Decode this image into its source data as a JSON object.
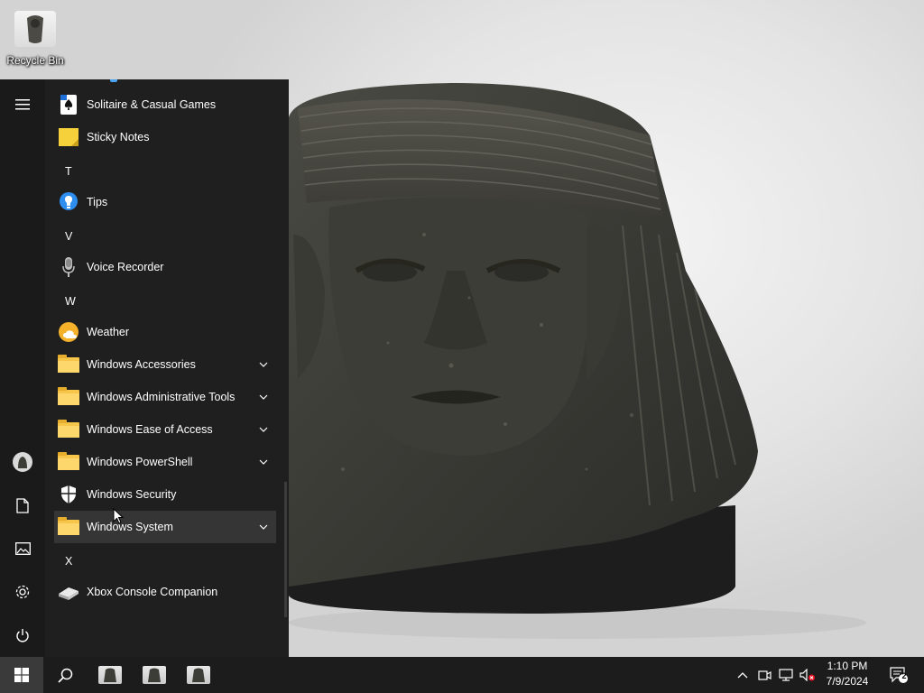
{
  "desktop": {
    "icons": [
      {
        "label": "Recycle Bin",
        "icon": "recycle-bin-icon"
      }
    ]
  },
  "start_menu": {
    "rail": {
      "menu": "hamburger-menu-icon",
      "account": "user-avatar",
      "documents": "document-icon",
      "pictures": "pictures-icon",
      "settings": "gear-icon",
      "power": "power-icon"
    },
    "apps": [
      {
        "label": "Solitaire & Casual Games",
        "icon": "solitaire-icon"
      },
      {
        "label": "Sticky Notes",
        "icon": "sticky-notes-icon"
      },
      {
        "letter": "T"
      },
      {
        "label": "Tips",
        "icon": "tips-lightbulb-icon"
      },
      {
        "letter": "V"
      },
      {
        "label": "Voice Recorder",
        "icon": "microphone-icon"
      },
      {
        "letter": "W"
      },
      {
        "label": "Weather",
        "icon": "weather-sun-icon"
      },
      {
        "label": "Windows Accessories",
        "icon": "folder-icon",
        "expandable": true
      },
      {
        "label": "Windows Administrative Tools",
        "icon": "folder-icon",
        "expandable": true
      },
      {
        "label": "Windows Ease of Access",
        "icon": "folder-icon",
        "expandable": true
      },
      {
        "label": "Windows PowerShell",
        "icon": "folder-icon",
        "expandable": true
      },
      {
        "label": "Windows Security",
        "icon": "shield-icon"
      },
      {
        "label": "Windows System",
        "icon": "folder-icon",
        "expandable": true,
        "hovered": true
      },
      {
        "letter": "X"
      },
      {
        "label": "Xbox Console Companion",
        "icon": "xbox-console-icon"
      }
    ]
  },
  "taskbar": {
    "start": "windows-logo-icon",
    "search": "search-icon",
    "pinned": [
      "app-thumbnail",
      "app-thumbnail",
      "app-thumbnail"
    ],
    "tray": {
      "overflow": "chevron-up-icon",
      "meet": "meet-now-icon",
      "network": "network-icon",
      "volume": "volume-muted-icon"
    },
    "clock": {
      "time": "1:10 PM",
      "date": "7/9/2024"
    },
    "notifications": {
      "icon": "action-center-icon",
      "count": "2"
    }
  },
  "colors": {
    "start_bg": "#1f1f1f",
    "taskbar_bg": "#1c1c1c",
    "folder": "#f6c54a",
    "accent_blue": "#4aa3f0"
  }
}
